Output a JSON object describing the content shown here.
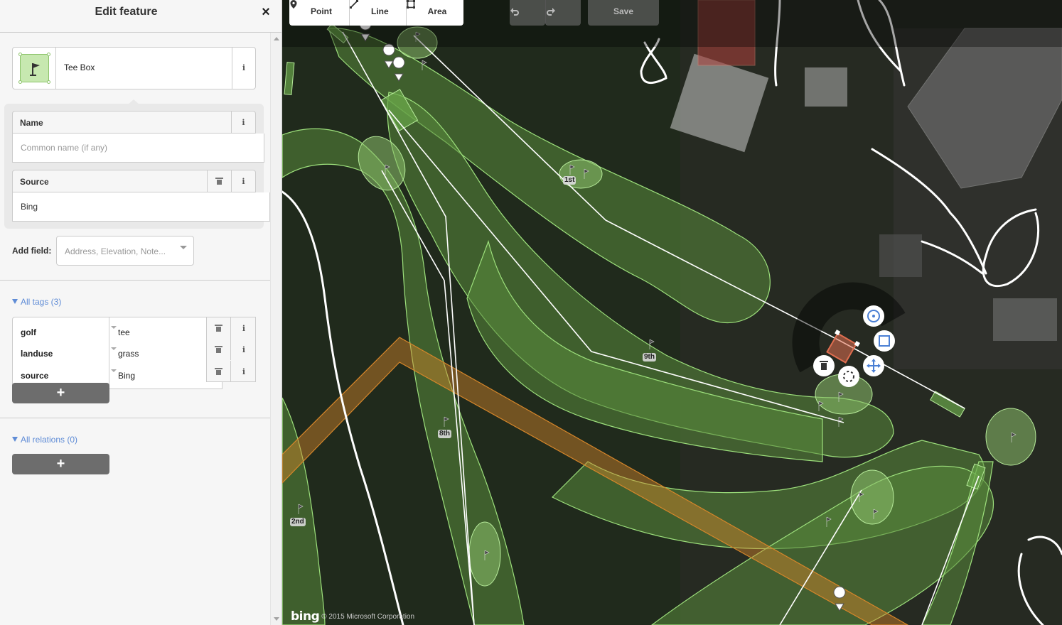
{
  "sidebar": {
    "title": "Edit feature",
    "close_label": "×",
    "preset": {
      "name": "Tee Box",
      "icon": "flag-icon"
    },
    "fields": {
      "name": {
        "label": "Name",
        "placeholder": "Common name (if any)"
      },
      "source": {
        "label": "Source",
        "value": "Bing"
      }
    },
    "add_field": {
      "label": "Add field:",
      "placeholder": "Address, Elevation, Note..."
    },
    "all_tags": {
      "label": "All tags (3)",
      "tags": [
        {
          "key": "golf",
          "value": "tee"
        },
        {
          "key": "landuse",
          "value": "grass"
        },
        {
          "key": "source",
          "value": "Bing"
        }
      ],
      "add_label": "+"
    },
    "all_relations": {
      "label": "All relations (0)",
      "add_label": "+"
    },
    "info_glyph": "i"
  },
  "toolbar": {
    "modes": [
      {
        "label": "Point",
        "icon": "point-icon"
      },
      {
        "label": "Line",
        "icon": "line-icon"
      },
      {
        "label": "Area",
        "icon": "area-icon"
      }
    ],
    "undo_icon": "undo-icon",
    "redo_icon": "redo-icon",
    "save_label": "Save"
  },
  "map": {
    "hole_labels": [
      "1st",
      "9th",
      "8th",
      "2nd"
    ],
    "attribution": {
      "logo": "bing",
      "text": "© 2015 Microsoft Corporation"
    },
    "accent_selected": "#e06e50",
    "fairway_fill": "#5a8a3c",
    "out_of_bounds_color": "#d6862a"
  }
}
